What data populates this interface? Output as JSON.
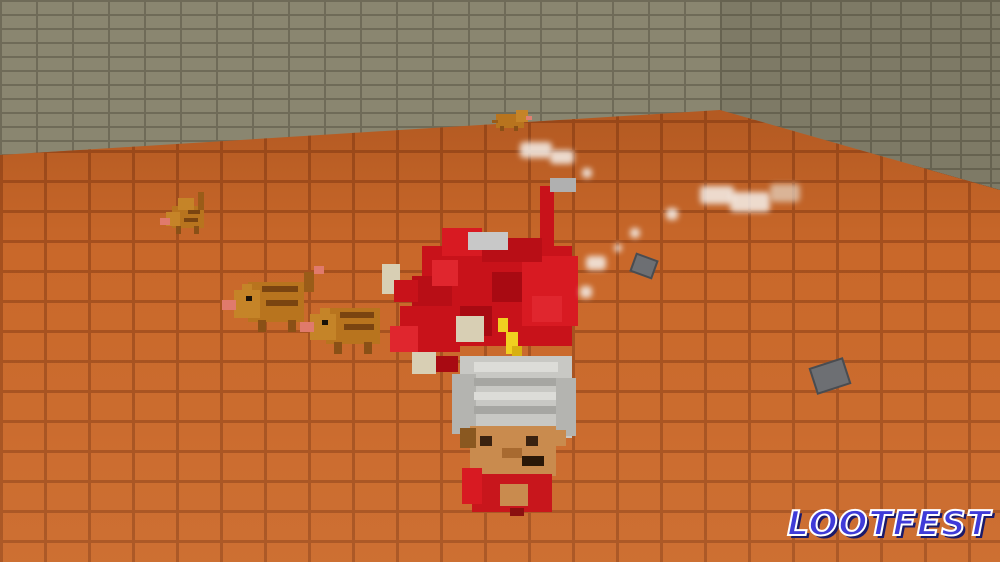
{
  "game": {
    "logo_text": "LOOTFEST"
  },
  "scene": {
    "floor_color": "#c9682a",
    "wall_color": "#8a8670",
    "player": {
      "name": "player-character",
      "helmet_color": "#c8c8c4",
      "tunic_color": "#c8161c"
    },
    "dragon": {
      "body_color": "#c8121a"
    },
    "rats": [
      "rat",
      "rat",
      "rat",
      "rat"
    ]
  }
}
